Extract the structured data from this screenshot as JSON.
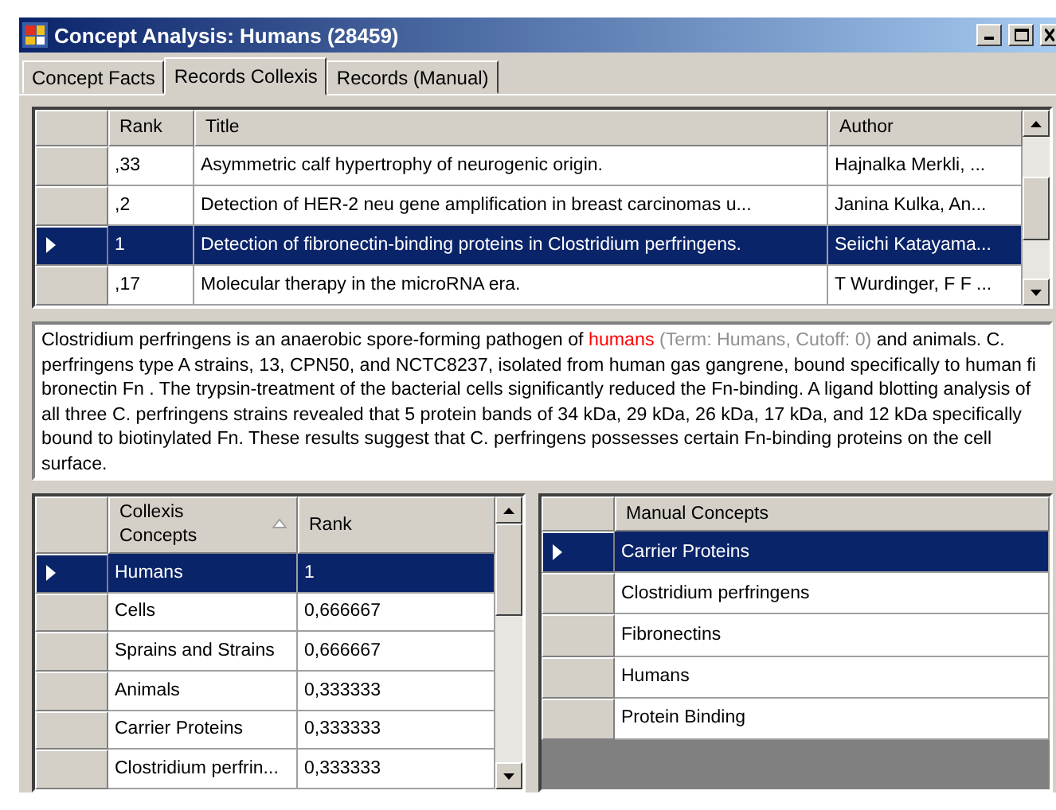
{
  "window": {
    "title": "Concept Analysis: Humans (28459)"
  },
  "tabs": [
    {
      "label": "Concept Facts",
      "selected": false
    },
    {
      "label": "Records Collexis",
      "selected": true
    },
    {
      "label": "Records (Manual)",
      "selected": false
    }
  ],
  "records": {
    "columns": [
      "Rank",
      "Title",
      "Author"
    ],
    "rows": [
      {
        "rank": ",33",
        "title": "Asymmetric calf hypertrophy of neurogenic origin.",
        "author": "Hajnalka Merkli, ...",
        "selected": false
      },
      {
        "rank": ",2",
        "title": "Detection of HER-2 neu gene amplification in breast carcinomas u...",
        "author": "Janina Kulka, An...",
        "selected": false
      },
      {
        "rank": "1",
        "title": "Detection of fibronectin-binding proteins in Clostridium perfringens.",
        "author": "Seiichi Katayama...",
        "selected": true
      },
      {
        "rank": ",17",
        "title": "Molecular therapy in the microRNA era.",
        "author": "T Wurdinger, F F ...",
        "selected": false
      }
    ]
  },
  "abstract": [
    {
      "kind": "normal",
      "text": "Clostridium perfringens is an anaerobic spore-forming pathogen of "
    },
    {
      "kind": "match",
      "text": "humans"
    },
    {
      "kind": "term",
      "text": " (Term: Humans, Cutoff: 0)"
    },
    {
      "kind": "normal",
      "text": " and animals. C. perfringens type A strains, 13, CPN50, and NCTC8237, isolated from human gas gangrene, bound specifically to human fi bronectin  Fn . The trypsin-treatment of the bacterial cells significantly reduced the Fn-binding. A ligand blotting analysis of all three C. perfringens strains revealed that 5 protein bands of 34 kDa, 29 kDa, 26 kDa, 17 kDa, and 12 kDa specifically bound to biotinylated Fn. These results suggest that C. perfringens possesses certain Fn-binding proteins on the cell surface."
    }
  ],
  "collexis_concepts": {
    "columns": [
      "Collexis Concepts",
      "Rank"
    ],
    "rows": [
      {
        "concept": "Humans",
        "rank": "1",
        "selected": true
      },
      {
        "concept": "Cells",
        "rank": "0,666667",
        "selected": false
      },
      {
        "concept": "Sprains and Strains",
        "rank": "0,666667",
        "selected": false
      },
      {
        "concept": "Animals",
        "rank": "0,333333",
        "selected": false
      },
      {
        "concept": "Carrier Proteins",
        "rank": "0,333333",
        "selected": false
      },
      {
        "concept": "Clostridium perfrin...",
        "rank": "0,333333",
        "selected": false
      }
    ]
  },
  "manual_concepts": {
    "columns": [
      "Manual Concepts"
    ],
    "rows": [
      {
        "concept": "Carrier Proteins",
        "selected": true
      },
      {
        "concept": "Clostridium perfringens",
        "selected": false
      },
      {
        "concept": "Fibronectins",
        "selected": false
      },
      {
        "concept": "Humans",
        "selected": false
      },
      {
        "concept": "Protein Binding",
        "selected": false
      }
    ]
  }
}
